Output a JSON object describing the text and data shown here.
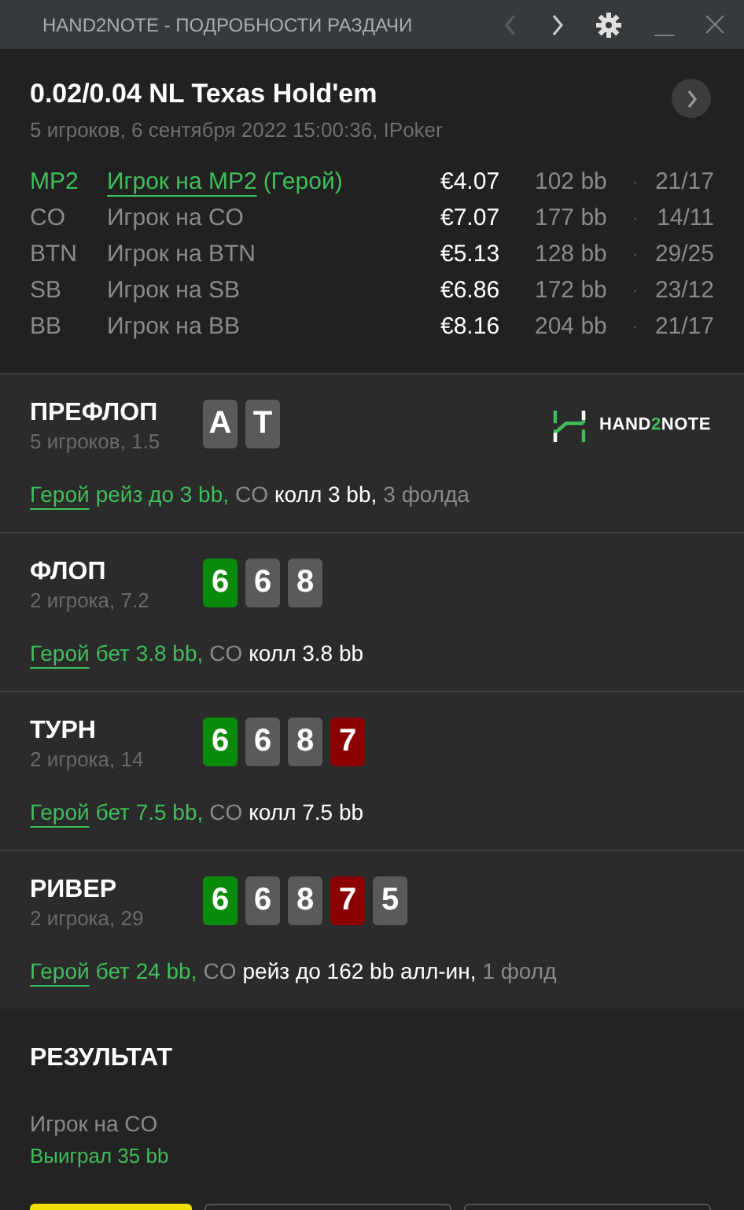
{
  "window": {
    "title": "HAND2NOTE - ПОДРОБНОСТИ РАЗДАЧИ"
  },
  "nav": [
    {
      "kind": "back",
      "disabled": true
    },
    {
      "kind": "forward",
      "disabled": false
    }
  ],
  "header": {
    "title": "0.02/0.04 NL Texas Hold'em",
    "subtitle": "5 игроков, 6 сентября 2022 15:00:36, IPoker"
  },
  "players": [
    {
      "position": "MP2",
      "name": "Игрок на MP2",
      "hero_tag": "(Герой)",
      "hero": true,
      "stack": "€4.07",
      "bb": "102 bb",
      "sep": "·",
      "stats": "21/17"
    },
    {
      "position": "CO",
      "name": "Игрок на CO",
      "hero": false,
      "stack": "€7.07",
      "bb": "177 bb",
      "sep": "·",
      "stats": "14/11"
    },
    {
      "position": "BTN",
      "name": "Игрок на BTN",
      "hero": false,
      "stack": "€5.13",
      "bb": "128 bb",
      "sep": "·",
      "stats": "29/25"
    },
    {
      "position": "SB",
      "name": "Игрок на SB",
      "hero": false,
      "stack": "€6.86",
      "bb": "172 bb",
      "sep": "·",
      "stats": "23/12"
    },
    {
      "position": "BB",
      "name": "Игрок на BB",
      "hero": false,
      "stack": "€8.16",
      "bb": "204 bb",
      "sep": "·",
      "stats": "21/17"
    }
  ],
  "logo": {
    "prefix": "HAND",
    "accent": "2",
    "suffix": "NOTE"
  },
  "streets": [
    {
      "name": "ПРЕФЛОП",
      "info": "5 игроков, 1.5",
      "logo": true,
      "cards": [
        {
          "rank": "A",
          "color": "#5a5a5a"
        },
        {
          "rank": "T",
          "color": "#5a5a5a"
        }
      ],
      "actions": [
        {
          "kind": "hero_link",
          "text": "Герой"
        },
        {
          "kind": "hero",
          "text": "рейз до 3 bb,"
        },
        {
          "kind": "player",
          "text": "CO"
        },
        {
          "kind": "action",
          "text": "колл 3 bb,"
        },
        {
          "kind": "muted",
          "text": "3 фолда"
        }
      ]
    },
    {
      "name": "ФЛОП",
      "info": "2 игрока, 7.2",
      "logo": false,
      "cards": [
        {
          "rank": "6",
          "color": "#0a8a0a"
        },
        {
          "rank": "6",
          "color": "#5a5a5a"
        },
        {
          "rank": "8",
          "color": "#5a5a5a"
        }
      ],
      "actions": [
        {
          "kind": "hero_link",
          "text": "Герой"
        },
        {
          "kind": "hero",
          "text": "бет 3.8 bb,"
        },
        {
          "kind": "player",
          "text": "CO"
        },
        {
          "kind": "action",
          "text": "колл 3.8 bb"
        }
      ]
    },
    {
      "name": "ТУРН",
      "info": "2 игрока, 14",
      "logo": false,
      "cards": [
        {
          "rank": "6",
          "color": "#0a8a0a"
        },
        {
          "rank": "6",
          "color": "#5a5a5a"
        },
        {
          "rank": "8",
          "color": "#5a5a5a"
        },
        {
          "rank": "7",
          "color": "#8b0000"
        }
      ],
      "actions": [
        {
          "kind": "hero_link",
          "text": "Герой"
        },
        {
          "kind": "hero",
          "text": "бет 7.5 bb,"
        },
        {
          "kind": "player",
          "text": "CO"
        },
        {
          "kind": "action",
          "text": "колл 7.5 bb"
        }
      ]
    },
    {
      "name": "РИВЕР",
      "info": "2 игрока, 29",
      "logo": false,
      "cards": [
        {
          "rank": "6",
          "color": "#0a8a0a"
        },
        {
          "rank": "6",
          "color": "#5a5a5a"
        },
        {
          "rank": "8",
          "color": "#5a5a5a"
        },
        {
          "rank": "7",
          "color": "#8b0000"
        },
        {
          "rank": "5",
          "color": "#5a5a5a"
        }
      ],
      "actions": [
        {
          "kind": "hero_link",
          "text": "Герой"
        },
        {
          "kind": "hero",
          "text": "бет 24 bb,"
        },
        {
          "kind": "player",
          "text": "CO"
        },
        {
          "kind": "action",
          "text": "рейз до 162 bb алл-ин,"
        },
        {
          "kind": "muted",
          "text": "1 фолд"
        }
      ]
    }
  ],
  "result": {
    "title": "РЕЗУЛЬТАТ",
    "player": "Игрок на CO",
    "outcome": "Выиграл 35 bb"
  },
  "bottom_buttons": [
    {
      "kind": "primary"
    },
    {
      "kind": "outline"
    },
    {
      "kind": "outline"
    }
  ]
}
